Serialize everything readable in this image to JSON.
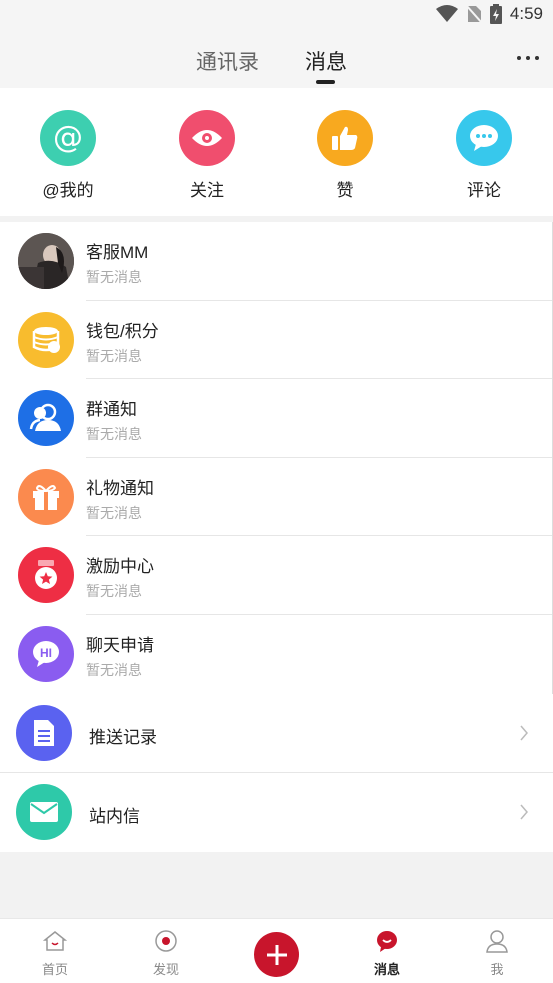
{
  "status_bar": {
    "time": "4:59"
  },
  "header": {
    "tabs": [
      {
        "label": "通讯录",
        "active": false
      },
      {
        "label": "消息",
        "active": true
      }
    ]
  },
  "quick_actions": [
    {
      "label": "@我的",
      "icon": "at-icon",
      "color": "#3dcfb0"
    },
    {
      "label": "关注",
      "icon": "eye-icon",
      "color": "#f04e6e"
    },
    {
      "label": "赞",
      "icon": "thumbs-up-icon",
      "color": "#f8a91f"
    },
    {
      "label": "评论",
      "icon": "comment-bubble-icon",
      "color": "#37c8ec"
    }
  ],
  "conversations": [
    {
      "title": "客服MM",
      "subtitle": "暂无消息",
      "icon": "avatar-photo"
    },
    {
      "title": "钱包/积分",
      "subtitle": "暂无消息",
      "icon": "coins-icon"
    },
    {
      "title": "群通知",
      "subtitle": "暂无消息",
      "icon": "group-icon"
    },
    {
      "title": "礼物通知",
      "subtitle": "暂无消息",
      "icon": "gift-icon"
    },
    {
      "title": "激励中心",
      "subtitle": "暂无消息",
      "icon": "medal-icon"
    },
    {
      "title": "聊天申请",
      "subtitle": "暂无消息",
      "icon": "hi-chat-icon"
    }
  ],
  "links": [
    {
      "title": "推送记录",
      "icon": "document-icon"
    },
    {
      "title": "站内信",
      "icon": "envelope-icon"
    }
  ],
  "bottom_nav": [
    {
      "label": "首页",
      "icon": "home-icon",
      "active": false
    },
    {
      "label": "发现",
      "icon": "discover-icon",
      "active": false
    },
    {
      "label": "",
      "icon": "plus-icon",
      "active": false
    },
    {
      "label": "消息",
      "icon": "message-icon",
      "active": true
    },
    {
      "label": "我",
      "icon": "profile-icon",
      "active": false
    }
  ]
}
